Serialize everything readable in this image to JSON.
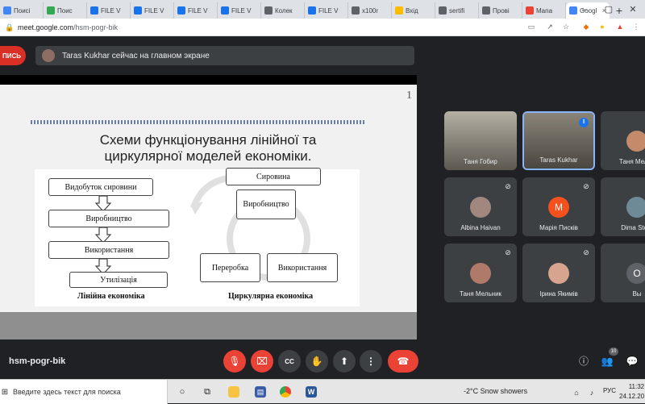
{
  "browser": {
    "tabs": [
      {
        "label": "Поисі",
        "icon": "search-icon",
        "color": "#4285f4"
      },
      {
        "label": "Поис",
        "icon": "leaf-icon",
        "color": "#34a853"
      },
      {
        "label": "FILE V",
        "icon": "file-icon",
        "color": "#1a73e8"
      },
      {
        "label": "FILE V",
        "icon": "file-icon",
        "color": "#1a73e8"
      },
      {
        "label": "FILE V",
        "icon": "file-icon",
        "color": "#1a73e8"
      },
      {
        "label": "FILE V",
        "icon": "file-icon",
        "color": "#1a73e8"
      },
      {
        "label": "Колек",
        "icon": "circle-icon",
        "color": "#5f6368"
      },
      {
        "label": "FILE V",
        "icon": "file-icon",
        "color": "#1a73e8"
      },
      {
        "label": "x100r",
        "icon": "dash-icon",
        "color": "#5f6368"
      },
      {
        "label": "Вхід",
        "icon": "download-icon",
        "color": "#fbbc04"
      },
      {
        "label": "sertifi",
        "icon": "globe-icon",
        "color": "#5f6368"
      },
      {
        "label": "Прові",
        "icon": "globe-icon",
        "color": "#5f6368"
      },
      {
        "label": "Mana",
        "icon": "s-icon",
        "color": "#ea4335"
      },
      {
        "label": "Googl",
        "icon": "google-icon",
        "color": "#4285f4"
      }
    ],
    "url_host": "meet.google.com",
    "url_path": "/hsm-pogr-bik"
  },
  "meet": {
    "record_label": "ПИСЬ",
    "presenting_text": "Taras Kukhar сейчас на главном экране",
    "meeting_code": "hsm-pogr-bik",
    "participant_count": "10"
  },
  "slide": {
    "page_number": "1",
    "title_line1": "Схеми функціонування лінійної та",
    "title_line2": "циркулярної моделей економіки.",
    "linear_boxes": [
      "Видобуток сировини",
      "Виробництво",
      "Використання",
      "Утилізація"
    ],
    "linear_caption": "Лінійна економіка",
    "circular_boxes": {
      "raw": "Сировина",
      "production": "Виробництво",
      "processing": "Переробка",
      "use": "Використання"
    },
    "circular_caption": "Циркулярна економіка"
  },
  "participants": [
    {
      "name": "Таня Гобир",
      "type": "video",
      "muted": false
    },
    {
      "name": "Taras Kukhar",
      "type": "video",
      "speaking": true
    },
    {
      "name": "Таня Мельн",
      "type": "avatar",
      "muted": true,
      "color": "#c48b6a"
    },
    {
      "name": "Albina Haivan",
      "type": "avatar",
      "muted": true,
      "color": "#a1887f"
    },
    {
      "name": "Марія Писків",
      "type": "letter",
      "letter": "M",
      "muted": true,
      "color": "#f4511e"
    },
    {
      "name": "Dima Stefa",
      "type": "avatar",
      "muted": true,
      "color": "#6d8a96"
    },
    {
      "name": "Таня Мельник",
      "type": "avatar",
      "muted": true,
      "color": "#b07a6a"
    },
    {
      "name": "Ірина Якимів",
      "type": "avatar",
      "muted": true,
      "color": "#d7a48f"
    },
    {
      "name": "Вы",
      "type": "letter",
      "letter": "O",
      "muted": true,
      "color": "#5f6368"
    }
  ],
  "taskbar": {
    "search_placeholder": "Введите здесь текст для поиска",
    "weather": "-2°C  Snow showers",
    "language": "РУС",
    "time": "11:32",
    "date": "24.12.20"
  }
}
